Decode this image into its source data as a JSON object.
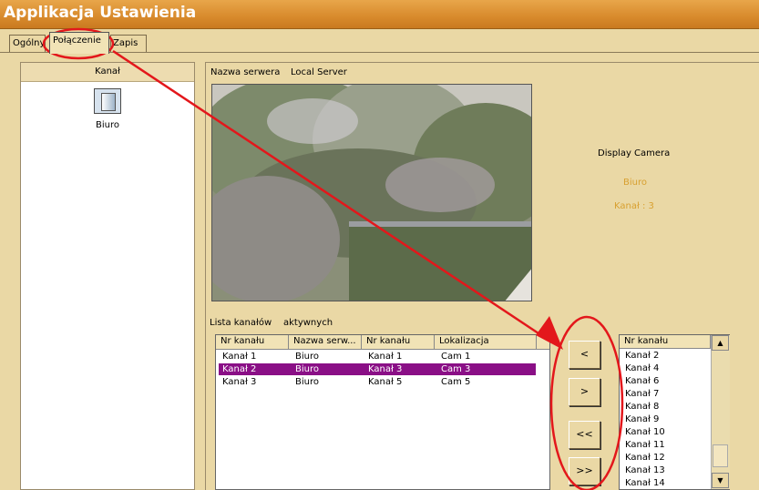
{
  "window": {
    "title": "Applikacja Ustawienia"
  },
  "tabs": [
    {
      "label": "Ogólny"
    },
    {
      "label": "Połączenie"
    },
    {
      "label": "Zapis"
    }
  ],
  "left_panel": {
    "header": "Kanał",
    "server_icon": "server-icon",
    "server_label": "Biuro"
  },
  "server": {
    "name_label": "Nazwa serwera",
    "name_value": "Local Server"
  },
  "display": {
    "title": "Display Camera",
    "camera_name": "Biuro",
    "channel": "Kanał : 3"
  },
  "active_list": {
    "label_1": "Lista kanałów",
    "label_2": "aktywnych",
    "columns": [
      "Nr kanału",
      "Nazwa serw...",
      "Nr kanału",
      "Lokalizacja"
    ],
    "rows": [
      [
        "Kanał  1",
        "Biuro",
        "Kanał  1",
        "Cam 1"
      ],
      [
        "Kanał  2",
        "Biuro",
        "Kanał  3",
        "Cam 3"
      ],
      [
        "Kanał  3",
        "Biuro",
        "Kanał  5",
        "Cam 5"
      ]
    ],
    "selected_row": 1
  },
  "transfer_buttons": {
    "left": "<",
    "right": ">",
    "all_left": "<<",
    "all_right": ">>"
  },
  "channel_list": {
    "header": "Nr kanału",
    "items": [
      "Kanał  2",
      "Kanał  4",
      "Kanał  6",
      "Kanał  7",
      "Kanał  8",
      "Kanał  9",
      "Kanał  10",
      "Kanał  11",
      "Kanał  12",
      "Kanał  13",
      "Kanał  14"
    ]
  },
  "colors": {
    "selection": "#8a0f86",
    "annotation": "#e3171b",
    "title_bar": "#d88a2c",
    "window_bg": "#ead8a5"
  }
}
